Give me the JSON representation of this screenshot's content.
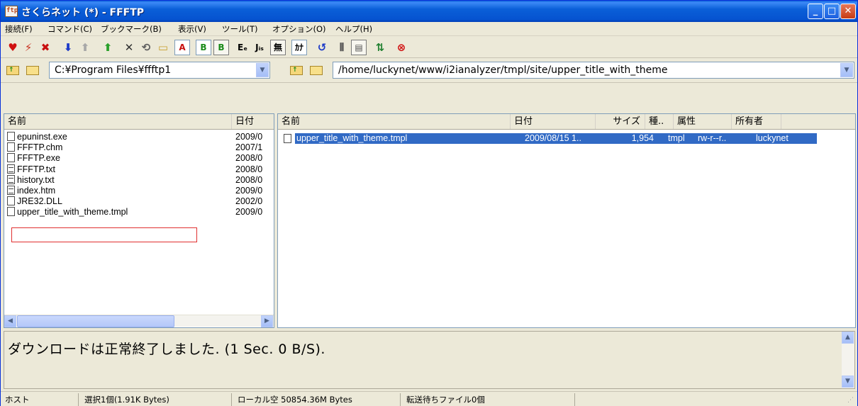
{
  "window": {
    "title": "さくらネット (*) - FFFTP",
    "icon_text": "ftp"
  },
  "menu": [
    "接続(F)",
    "コマンド(C)",
    "ブックマーク(B)",
    "表示(V)",
    "ツール(T)",
    "オプション(O)",
    "ヘルプ(H)"
  ],
  "toolbar": {
    "icons": [
      "connect-icon",
      "quick-connect-icon",
      "disconnect-icon",
      "download-icon",
      "upload-icon",
      "mirror-upload-icon",
      "delete-icon",
      "rename-icon",
      "mkdir-icon",
      "ascii-mode-icon",
      "binary-mode-icon",
      "auto-mode-icon",
      "euc-icon",
      "jis-icon",
      "no-convert-icon",
      "kana-icon",
      "refresh-icon",
      "list-view-icon",
      "detail-view-icon",
      "sync-icon",
      "stop-icon"
    ],
    "labels": [
      "A",
      "B",
      "B",
      "Eₑ",
      "Jᵢₛ",
      "無",
      "ｶﾅ"
    ]
  },
  "local": {
    "path": "C:¥Program Files¥ffftp1",
    "columns": [
      "名前",
      "日付"
    ],
    "files": [
      {
        "name": "epuninst.exe",
        "date": "2009/0",
        "type": "file"
      },
      {
        "name": "FFFTP.chm",
        "date": "2007/1",
        "type": "file"
      },
      {
        "name": "FFFTP.exe",
        "date": "2008/0",
        "type": "file"
      },
      {
        "name": "FFFTP.txt",
        "date": "2008/0",
        "type": "text"
      },
      {
        "name": "history.txt",
        "date": "2008/0",
        "type": "text"
      },
      {
        "name": "index.htm",
        "date": "2009/0",
        "type": "text"
      },
      {
        "name": "JRE32.DLL",
        "date": "2002/0",
        "type": "file"
      },
      {
        "name": "upper_title_with_theme.tmpl",
        "date": "2009/0",
        "type": "file",
        "highlighted": true
      }
    ]
  },
  "remote": {
    "path": "/home/luckynet/www/i2ianalyzer/tmpl/site/upper_title_with_theme",
    "columns": [
      "名前",
      "日付",
      "サイズ",
      "種..",
      "属性",
      "所有者"
    ],
    "files": [
      {
        "name": "upper_title_with_theme.tmpl",
        "date": "2009/08/15 1..",
        "size": "1,954",
        "kind": "tmpl",
        "attr": "rw-r--r..",
        "owner": "luckynet",
        "selected": true
      }
    ]
  },
  "log": {
    "message": "ダウンロードは正常終了しました. (1 Sec. 0 B/S)."
  },
  "status": {
    "host": "ホスト",
    "selection": "選択1個(1.91K Bytes)",
    "local_free": "ローカル空 50854.36M Bytes",
    "queue": "転送待ちファイル0個"
  },
  "colors": {
    "title_bar": "#0a5fd8",
    "selection": "#316ac5",
    "highlight_box": "#e03030"
  }
}
